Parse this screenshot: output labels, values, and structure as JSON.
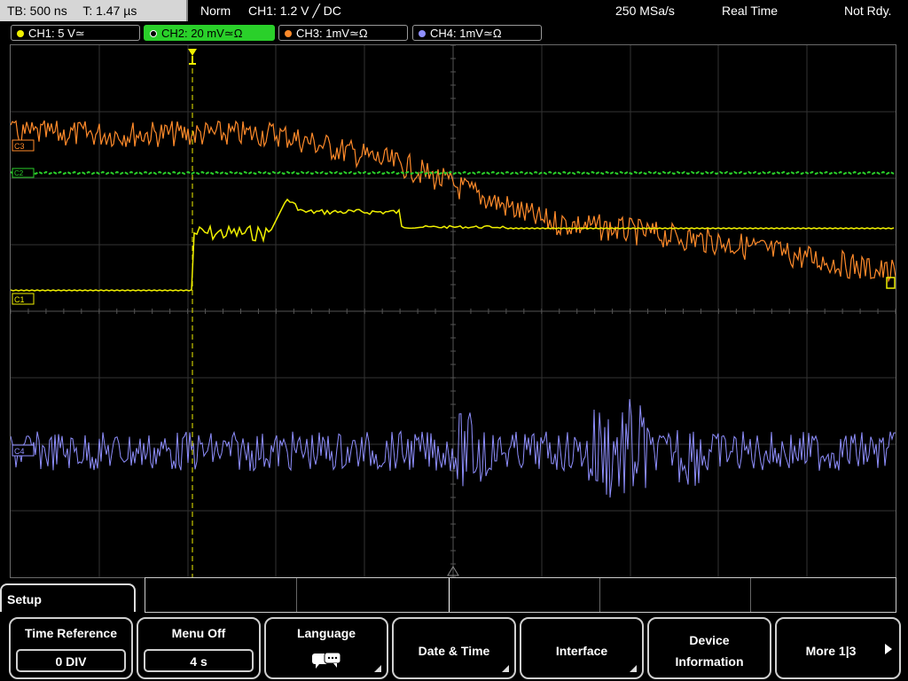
{
  "topbar": {
    "tb": "TB: 500 ns",
    "t": "T: 1.47 µs",
    "mode": "Norm",
    "trigger": "CH1: 1.2 V ╱ DC",
    "samplerate": "250 MSa/s",
    "acq": "Real Time",
    "state": "Not Rdy."
  },
  "channels": [
    {
      "label": "CH1: 5 V≃",
      "color": "#f0f000"
    },
    {
      "label": "CH2: 20 mV≃Ω",
      "color": "#2ad02a"
    },
    {
      "label": "CH3: 1mV≃Ω",
      "color": "#ff8a2a"
    },
    {
      "label": "CH4: 1mV≃Ω",
      "color": "#8f8fff"
    }
  ],
  "markers": {
    "ch1": "C1",
    "ch2": "C2",
    "ch3": "C3",
    "ch4": "C4"
  },
  "menu": {
    "title": "Setup",
    "time_reference": {
      "label": "Time Reference",
      "value": "0 DIV"
    },
    "menu_off": {
      "label": "Menu Off",
      "value": "4 s"
    },
    "language": {
      "label": "Language",
      "icon": "speech-bubbles-icon"
    },
    "date_time": {
      "label": "Date & Time"
    },
    "interface": {
      "label": "Interface"
    },
    "device_info": {
      "label1": "Device",
      "label2": "Information"
    },
    "more": {
      "label": "More 1|3"
    }
  },
  "colors": {
    "ch1": "#f0f000",
    "ch2": "#2ad02a",
    "ch3": "#ff8a2a",
    "ch4": "#8f8fff"
  }
}
